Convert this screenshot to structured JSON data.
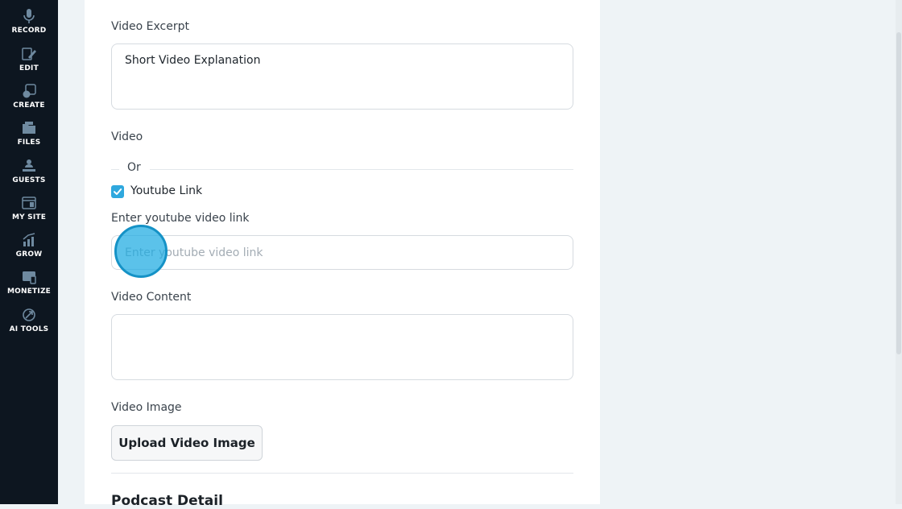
{
  "sidebar": {
    "items": [
      {
        "label": "RECORD",
        "icon": "microphone-icon"
      },
      {
        "label": "EDIT",
        "icon": "edit-icon"
      },
      {
        "label": "CREATE",
        "icon": "create-icon"
      },
      {
        "label": "FILES",
        "icon": "files-icon"
      },
      {
        "label": "GUESTS",
        "icon": "guests-icon"
      },
      {
        "label": "MY SITE",
        "icon": "my-site-icon"
      },
      {
        "label": "GROW",
        "icon": "grow-icon"
      },
      {
        "label": "MONETIZE",
        "icon": "monetize-icon"
      },
      {
        "label": "AI TOOLS",
        "icon": "ai-tools-icon"
      }
    ]
  },
  "form": {
    "excerpt_label": "Video Excerpt",
    "excerpt_value": "Short Video Explanation",
    "video_label": "Video",
    "or_text": "Or",
    "youtube_checkbox_label": "Youtube Link",
    "youtube_checked": true,
    "youtube_link_label": "Enter youtube video link",
    "youtube_link_placeholder": "Enter youtube video link",
    "youtube_link_value": "",
    "content_label": "Video Content",
    "content_value": "",
    "image_label": "Video Image",
    "upload_button": "Upload Video Image",
    "section_title": "Podcast Detail"
  },
  "colors": {
    "sidebar_bg": "#0d1620",
    "accent": "#2fa8de",
    "page_bg": "#eef3f6"
  }
}
